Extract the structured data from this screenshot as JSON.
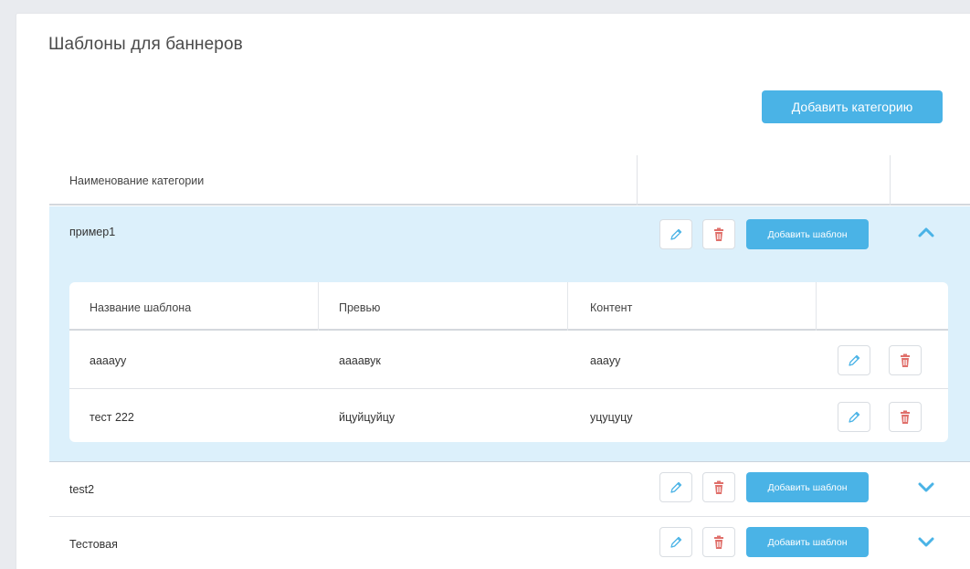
{
  "page": {
    "title": "Шаблоны для баннеров"
  },
  "toolbar": {
    "add_category_label": "Добавить категорию"
  },
  "table": {
    "header_name": "Наименование категории"
  },
  "categories": [
    {
      "name": "пример1",
      "add_template_label": "Добавить шаблон",
      "expanded": true,
      "templates_header": {
        "name": "Название шаблона",
        "preview": "Превью",
        "content": "Контент"
      },
      "templates": [
        {
          "name": "aaaayy",
          "preview": "aaaaвук",
          "content": "aaayy"
        },
        {
          "name": "тест 222",
          "preview": "йцуйцуйцу",
          "content": "уцуцуцу"
        }
      ]
    },
    {
      "name": "test2",
      "add_template_label": "Добавить шаблон",
      "expanded": false
    },
    {
      "name": "Тестовая",
      "add_template_label": "Добавить шаблон",
      "expanded": false
    }
  ],
  "colors": {
    "accent": "#4ab3e6",
    "expanded_bg": "#dcf0fb",
    "delete_icon": "#e0706b",
    "edit_icon": "#4ab3e6"
  },
  "icons": {
    "edit": "pencil-icon",
    "delete": "trash-icon",
    "collapse": "chevron-up-icon",
    "expand": "chevron-down-icon"
  }
}
